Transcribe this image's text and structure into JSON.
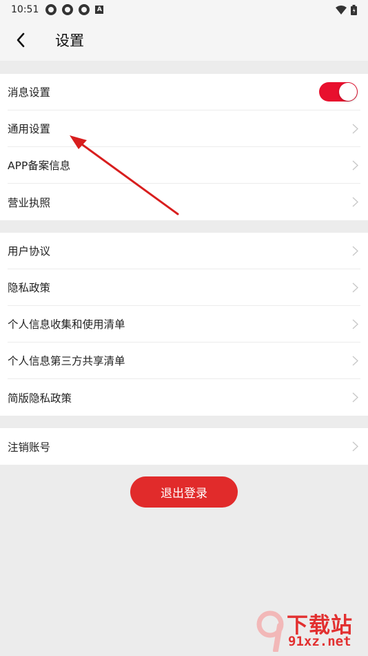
{
  "status_bar": {
    "time": "10:51",
    "icon_letter": "A"
  },
  "header": {
    "title": "设置"
  },
  "groups": [
    {
      "rows": [
        {
          "label": "消息设置",
          "toggle_on": true
        },
        {
          "label": "通用设置"
        },
        {
          "label": "APP备案信息"
        },
        {
          "label": "营业执照"
        }
      ]
    },
    {
      "rows": [
        {
          "label": "用户协议"
        },
        {
          "label": "隐私政策"
        },
        {
          "label": "个人信息收集和使用清单"
        },
        {
          "label": "个人信息第三方共享清单"
        },
        {
          "label": "简版隐私政策"
        }
      ]
    },
    {
      "rows": [
        {
          "label": "注销账号"
        }
      ]
    }
  ],
  "logout": {
    "label": "退出登录"
  },
  "watermark": {
    "title": "下载站",
    "url": "91xz.net",
    "logo_text": "9"
  },
  "colors": {
    "accent": "#e8102e",
    "logout": "#e12b2b",
    "annotation_arrow": "#d81e1e"
  }
}
